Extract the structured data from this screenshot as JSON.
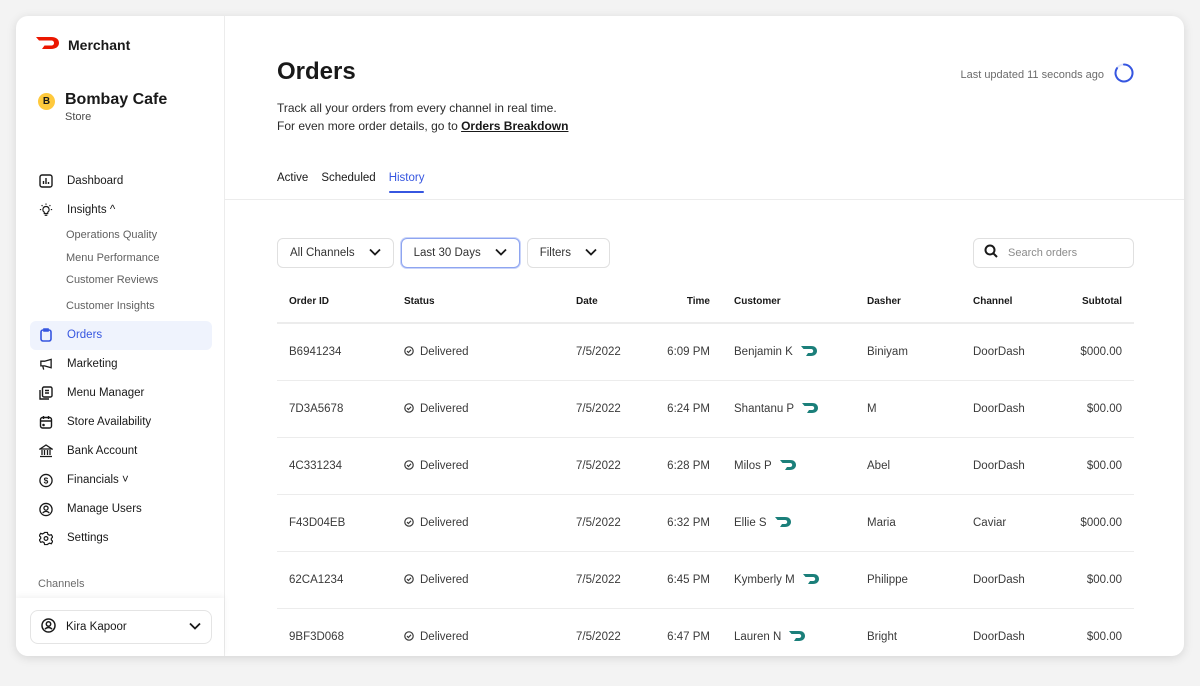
{
  "brand": {
    "name": "Merchant",
    "logo_color": "#eb1700"
  },
  "store": {
    "initial": "B",
    "name": "Bombay Cafe",
    "type": "Store"
  },
  "sidebar": {
    "items": [
      {
        "label": "Dashboard",
        "icon": "chart-icon"
      },
      {
        "label": "Insights ^",
        "icon": "lightbulb-icon"
      },
      {
        "label": "Orders",
        "icon": "clipboard-icon",
        "active": true
      },
      {
        "label": "Marketing",
        "icon": "megaphone-icon"
      },
      {
        "label": "Menu Manager",
        "icon": "menu-icon"
      },
      {
        "label": "Store Availability",
        "icon": "calendar-icon"
      },
      {
        "label": "Bank Account",
        "icon": "bank-icon"
      },
      {
        "label": "Financials ˅",
        "icon": "dollar-icon"
      },
      {
        "label": "Manage Users",
        "icon": "user-icon"
      },
      {
        "label": "Settings",
        "icon": "gear-icon"
      }
    ],
    "insights_sub": [
      "Operations Quality",
      "Menu Performance",
      "Customer Reviews",
      "Customer Insights"
    ],
    "section_label": "Channels",
    "user": {
      "name": "Kira Kapoor"
    }
  },
  "header": {
    "title": "Orders",
    "subtitle_line1": "Track all your orders from every channel in real time.",
    "subtitle_line2": "For even more order details, go to ",
    "subtitle_link": "Orders Breakdown",
    "last_updated": "Last updated 11 seconds ago"
  },
  "tabs": [
    {
      "label": "Active"
    },
    {
      "label": "Scheduled"
    },
    {
      "label": "History",
      "active": true
    }
  ],
  "filters": {
    "channels": "All Channels",
    "date_range": "Last 30 Days",
    "filters": "Filters",
    "search_placeholder": "Search orders"
  },
  "colors": {
    "accent": "#3656e0",
    "dasher_icon": "#1b7f7a",
    "active_bg": "#eff3fd"
  },
  "table": {
    "columns": [
      "Order ID",
      "Status",
      "Date",
      "Time",
      "Customer",
      "Dasher",
      "Channel",
      "Subtotal"
    ],
    "rows": [
      {
        "order_id": "B6941234",
        "status": "Delivered",
        "date": "7/5/2022",
        "time": "6:09 PM",
        "customer": "Benjamin K",
        "dasher": "Biniyam",
        "channel": "DoorDash",
        "subtotal": "$000.00"
      },
      {
        "order_id": "7D3A5678",
        "status": "Delivered",
        "date": "7/5/2022",
        "time": "6:24 PM",
        "customer": "Shantanu P",
        "dasher": "M",
        "channel": "DoorDash",
        "subtotal": "$00.00"
      },
      {
        "order_id": "4C331234",
        "status": "Delivered",
        "date": "7/5/2022",
        "time": "6:28 PM",
        "customer": "Milos P",
        "dasher": "Abel",
        "channel": "DoorDash",
        "subtotal": "$00.00"
      },
      {
        "order_id": "F43D04EB",
        "status": "Delivered",
        "date": "7/5/2022",
        "time": "6:32 PM",
        "customer": "Ellie S",
        "dasher": "Maria",
        "channel": "Caviar",
        "subtotal": "$000.00"
      },
      {
        "order_id": "62CA1234",
        "status": "Delivered",
        "date": "7/5/2022",
        "time": "6:45 PM",
        "customer": "Kymberly M",
        "dasher": "Philippe",
        "channel": "DoorDash",
        "subtotal": "$00.00"
      },
      {
        "order_id": "9BF3D068",
        "status": "Delivered",
        "date": "7/5/2022",
        "time": "6:47 PM",
        "customer": "Lauren N",
        "dasher": "Bright",
        "channel": "DoorDash",
        "subtotal": "$00.00"
      }
    ]
  }
}
